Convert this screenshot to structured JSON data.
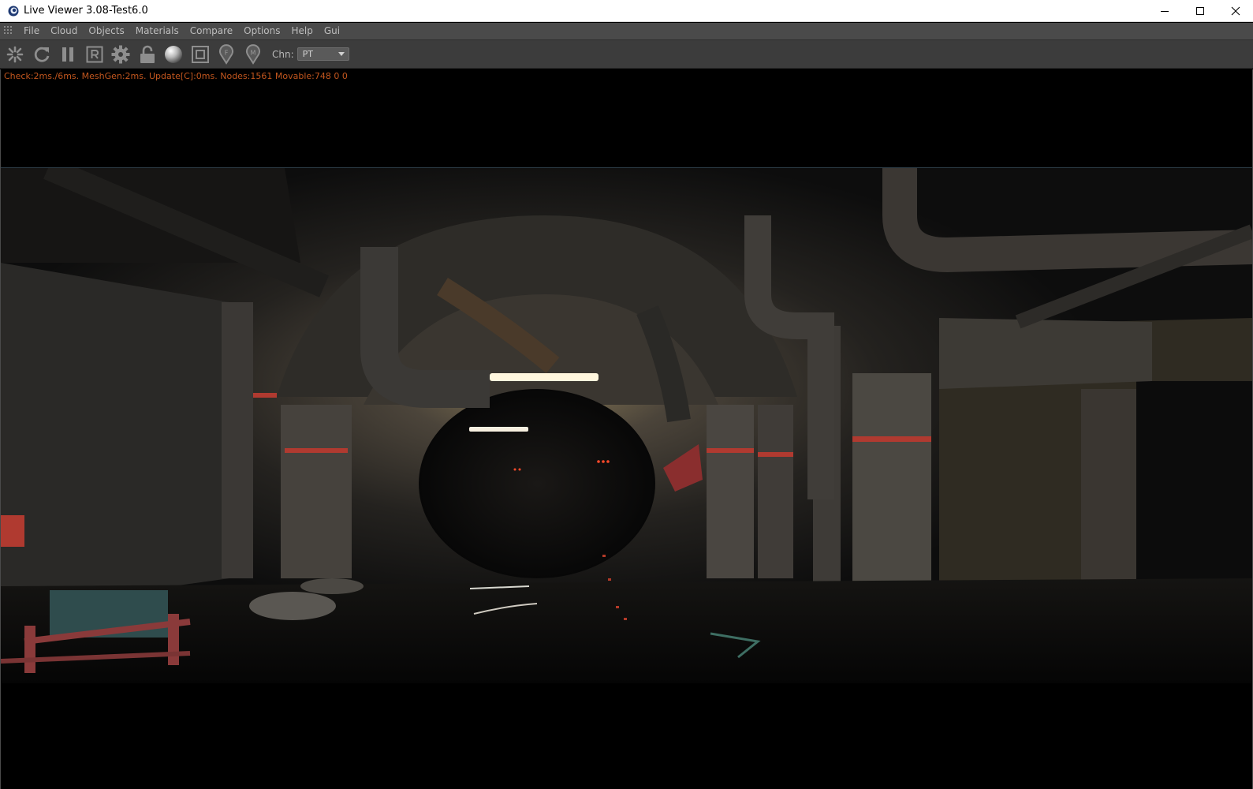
{
  "window": {
    "title": "Live Viewer 3.08-Test6.0"
  },
  "menu": {
    "items": [
      "File",
      "Cloud",
      "Objects",
      "Materials",
      "Compare",
      "Options",
      "Help",
      "Gui"
    ]
  },
  "toolbar": {
    "buttons": [
      {
        "icon": "camera-lock-icon"
      },
      {
        "icon": "refresh-icon"
      },
      {
        "icon": "pause-icon"
      },
      {
        "icon": "region-render-icon"
      },
      {
        "icon": "settings-gear-icon"
      },
      {
        "icon": "lock-open-icon"
      },
      {
        "icon": "material-sphere-icon"
      },
      {
        "icon": "film-frame-icon"
      },
      {
        "icon": "focus-pin-icon"
      },
      {
        "icon": "material-pin-icon"
      }
    ],
    "channel_label": "Chn:",
    "channel_value": "PT"
  },
  "viewport": {
    "stats": "Check:2ms./6ms. MeshGen:2ms. Update[C]:0ms. Nodes:1561 Movable:748  0 0"
  },
  "colors": {
    "menu_bg": "#4a4a4a",
    "toolbar_bg": "#3c3c3c",
    "stats_text": "#c2561e",
    "viewport_bg": "#000000"
  }
}
